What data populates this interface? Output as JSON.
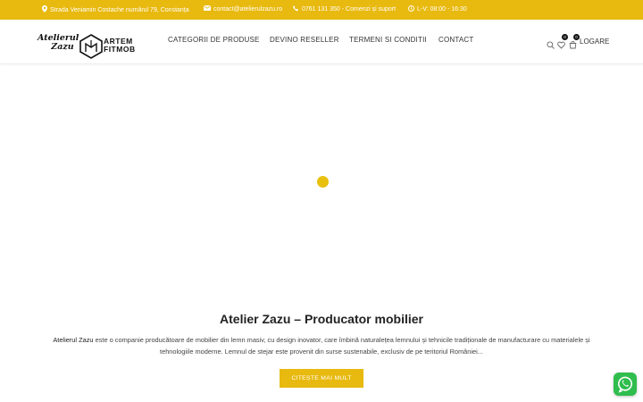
{
  "topbar": {
    "address": "Strada Veniamin Costache numărul 79, Constanța",
    "email": "contact@atelierulzazu.ro",
    "phone": "0761 131 350 - Comenzi și suport",
    "hours": "L-V: 08:00 - 16:30"
  },
  "logo": {
    "script_line1": "Atelierul",
    "script_line2": "Zazu",
    "brand_line1": "ARTEM",
    "brand_line2": "FITMOB"
  },
  "nav": {
    "items": [
      {
        "label": "CATEGORII DE PRODUSE"
      },
      {
        "label": "DEVINO RESELLER"
      },
      {
        "label": "TERMENI SI CONDITII"
      },
      {
        "label": "CONTACT"
      }
    ]
  },
  "header": {
    "wishlist_count": "0",
    "cart_count": "0",
    "login_label": "LOGARE"
  },
  "content": {
    "title": "Atelier Zazu – Producator mobilier",
    "desc_lead": "Atelierul Zazu",
    "desc_rest": " este o companie producătoare de mobilier din lemn masiv, cu design inovator, care îmbină naturalețea lemnului și tehnicile tradiționale de manufacturare cu materialele și tehnologiile moderne. Lemnul de stejar este provenit din surse sustenabile, exclusiv de pe teritoriul României...",
    "cta_label": "CITEȘTE MAI MULT"
  },
  "colors": {
    "accent": "#e8b90f",
    "whatsapp": "#2fbd4d"
  },
  "icons": [
    "map-marker-icon",
    "envelope-icon",
    "phone-icon",
    "clock-icon",
    "search-icon",
    "heart-icon",
    "cart-icon",
    "whatsapp-icon"
  ]
}
